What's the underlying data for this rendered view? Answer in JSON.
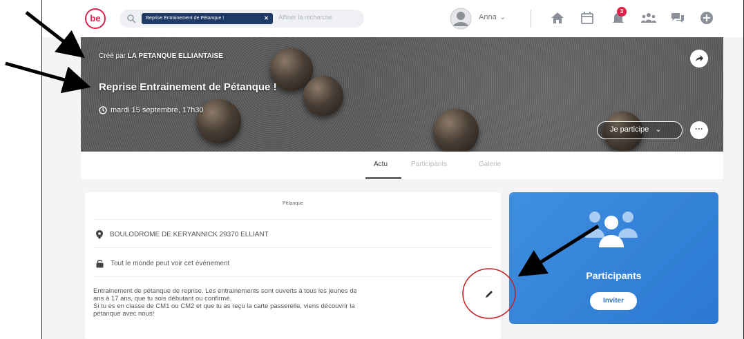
{
  "topbar": {
    "logo_text": "be",
    "search_chip": "Reprise Entrainement de Pétanque !",
    "search_placeholder": "Affiner la recherche",
    "user_name": "Anna",
    "notification_count": "3"
  },
  "cover": {
    "created_prefix": "Créé par",
    "organizer": "LA PETANQUE ELLIANTAISE",
    "title": "Reprise Entrainement de Pétanque !",
    "date": "mardi 15 septembre, 17h30",
    "participate_label": "Je participe",
    "more_label": "···"
  },
  "tabs": [
    "Actu",
    "Participants",
    "Galerie"
  ],
  "info": {
    "category": "Pétanque",
    "location": "BOULODROME DE KERYANNICK 29370 ELLIANT",
    "visibility": "Tout le monde peut voir cet événement",
    "description_lines": [
      "Entrainement de pétanque de reprise. Les entrainements sont ouverts à tous les jeunes de",
      "ans à 17 ans, que tu sois débutant ou confirmé.",
      "Si tu es en classe de CM1 ou CM2 et que tu as reçu la carte passerelle, viens découvrir la",
      "pétanque avec nous!"
    ]
  },
  "participants_card": {
    "title": "Participants",
    "invite_label": "Inviter"
  },
  "colors": {
    "brand": "#e0204a",
    "participants_blue": "#3f8fe0",
    "annotation_red": "#c81e1e"
  }
}
